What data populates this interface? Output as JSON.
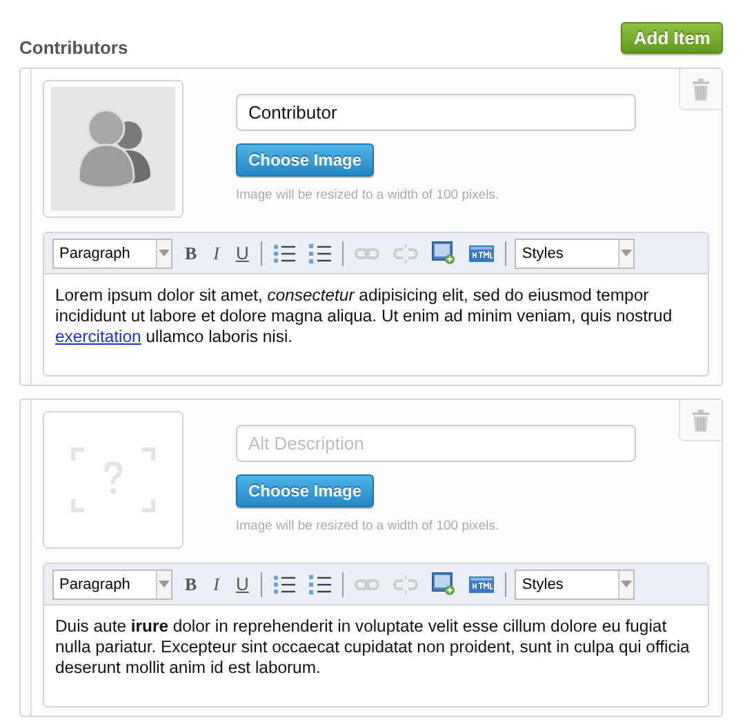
{
  "section": {
    "title": "Contributors",
    "add_button": "Add Item"
  },
  "items": [
    {
      "image": {
        "kind": "avatar"
      },
      "alt_field": {
        "value": "Contributor"
      },
      "choose_button": "Choose Image",
      "hint": "Image will be resized to a width of 100 pixels.",
      "toolbar": [
        {
          "kind": "select",
          "value": "Paragraph"
        },
        {
          "kind": "bold",
          "label": "B"
        },
        {
          "kind": "italic",
          "label": "I"
        },
        {
          "kind": "underline",
          "label": "U"
        },
        {
          "kind": "separator"
        },
        {
          "kind": "bullets"
        },
        {
          "kind": "numbers"
        },
        {
          "kind": "separator"
        },
        {
          "kind": "link",
          "disabled": true
        },
        {
          "kind": "unlink",
          "disabled": true
        },
        {
          "kind": "image"
        },
        {
          "kind": "html"
        },
        {
          "kind": "separator"
        },
        {
          "kind": "select",
          "value": "Styles"
        }
      ],
      "body": [
        {
          "kind": "text",
          "text": "Lorem ipsum dolor sit amet, *consectetur* adipisicing elit, sed do eiusmod tempor incididunt ut labore et dolore magna aliqua. Ut enim ad minim veniam, quis nostrud "
        },
        {
          "kind": "link",
          "text": "exercitation"
        },
        {
          "kind": "text",
          "text": " ullamco laboris nisi."
        }
      ]
    },
    {
      "image": {
        "kind": "empty"
      },
      "alt_field": {
        "placeholder": "Alt Description"
      },
      "choose_button": "Choose Image",
      "hint": "Image will be resized to a width of 100 pixels.",
      "toolbar": [
        {
          "kind": "select",
          "value": "Paragraph"
        },
        {
          "kind": "bold",
          "label": "B"
        },
        {
          "kind": "italic",
          "label": "I"
        },
        {
          "kind": "underline",
          "label": "U"
        },
        {
          "kind": "separator"
        },
        {
          "kind": "bullets"
        },
        {
          "kind": "numbers"
        },
        {
          "kind": "separator"
        },
        {
          "kind": "link",
          "disabled": true
        },
        {
          "kind": "unlink",
          "disabled": true
        },
        {
          "kind": "image"
        },
        {
          "kind": "html"
        },
        {
          "kind": "separator"
        },
        {
          "kind": "select",
          "value": "Styles"
        }
      ],
      "body": [
        {
          "kind": "text",
          "text": "Duis aute **irure** dolor in reprehenderit in voluptate velit esse cillum dolore eu fugiat nulla pariatur. Excepteur sint occaecat cupidatat non proident, sunt in culpa qui officia deserunt mollit anim id est laborum."
        }
      ]
    }
  ]
}
